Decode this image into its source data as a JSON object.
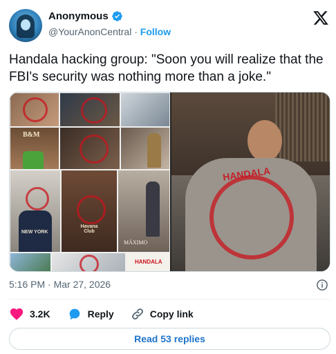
{
  "author": {
    "name": "Anonymous",
    "handle": "@YourAnonCentral",
    "separator": "·",
    "follow_label": "Follow"
  },
  "tweet": {
    "text": "Handala hacking group: \"Soon you will realize that the FBI's security was nothing more than a joke.\"",
    "timestamp": "5:16 PM · Mar 27, 2026"
  },
  "media": {
    "collage_labels": {
      "bm": "B&M",
      "shirt": "NEW YORK",
      "havana": "Havana Club",
      "maximo": "MÁXIMO"
    },
    "stamp_text": "HANDALA"
  },
  "actions": {
    "likes": "3.2K",
    "reply_label": "Reply",
    "copy_link_label": "Copy link"
  },
  "read_replies_label": "Read 53 replies",
  "colors": {
    "accent": "#1d9bf0",
    "like": "#f91880",
    "stamp": "#c8141e"
  }
}
